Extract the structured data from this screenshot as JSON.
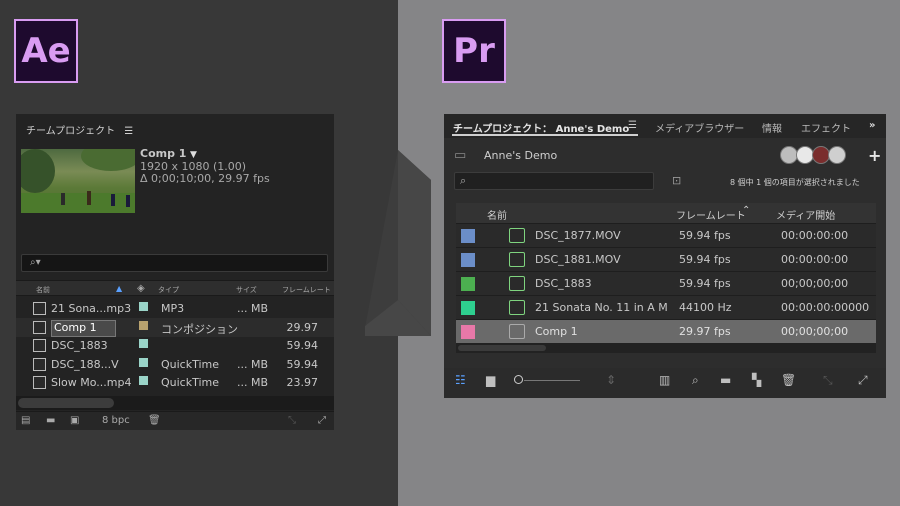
{
  "ae": {
    "logo": "Ae",
    "panel_title": "チームプロジェクト",
    "menu_icon": "hamburger-icon",
    "comp_name": "Comp 1",
    "comp_res": "1920 x 1080 (1.00)",
    "comp_dur": "Δ 0;00;10;00, 29.97 fps",
    "search_placeholder": "",
    "columns": {
      "name": "名前",
      "type": "タイプ",
      "size": "サイズ",
      "rate": "フレームレート"
    },
    "rows": [
      {
        "name": "21 Sona...mp3",
        "type": "MP3",
        "size": "... MB",
        "rate": "",
        "swatch": "#9ad4c8",
        "icon": "audio-file-icon"
      },
      {
        "name": "Comp 1",
        "type": "コンポジション",
        "size": "",
        "rate": "29.97",
        "swatch": "#b8a26e",
        "icon": "composition-icon",
        "selected": true
      },
      {
        "name": "DSC_1883",
        "type": "",
        "size": "",
        "rate": "59.94",
        "swatch": "#9ad4c8",
        "icon": "image-sequence-icon"
      },
      {
        "name": "DSC_188...V",
        "type": "QuickTime",
        "size": "... MB",
        "rate": "59.94",
        "swatch": "#9ad4c8",
        "icon": "video-file-icon"
      },
      {
        "name": "Slow Mo...mp4",
        "type": "QuickTime",
        "size": "... MB",
        "rate": "23.97",
        "swatch": "#9ad4c8",
        "icon": "video-file-icon"
      }
    ],
    "footer_bpc": "8 bpc"
  },
  "pr": {
    "logo": "Pr",
    "tabs": {
      "project": "チームプロジェクト： Anne's Demo",
      "media_browser": "メディアブラウザー",
      "info": "情報",
      "effects": "エフェクト"
    },
    "project_name": "Anne's Demo",
    "selection_status": "8 個中 1 個の項目が選択されました",
    "columns": {
      "name": "名前",
      "rate": "フレームレート",
      "start": "メディア開始"
    },
    "rows": [
      {
        "name": "DSC_1877.MOV",
        "rate": "59.94 fps",
        "start": "00:00:00:00",
        "swatch": "#6b8ec8",
        "icon": "video-clip-icon"
      },
      {
        "name": "DSC_1881.MOV",
        "rate": "59.94 fps",
        "start": "00:00:00:00",
        "swatch": "#6b8ec8",
        "icon": "video-clip-icon"
      },
      {
        "name": "DSC_1883",
        "rate": "59.94 fps",
        "start": "00;00;00;00",
        "swatch": "#4caf50",
        "icon": "image-sequence-icon"
      },
      {
        "name": "21 Sonata No. 11 in A M",
        "rate": "44100 Hz",
        "start": "00:00:00:00000",
        "swatch": "#2ecf8f",
        "icon": "audio-clip-icon"
      },
      {
        "name": "Comp 1",
        "rate": "29.97 fps",
        "start": "00;00;00;00",
        "swatch": "#e878a8",
        "icon": "composition-icon",
        "selected": true
      }
    ],
    "colors": {
      "accent": "#d99cf2",
      "logo_bg": "#1e0a2e"
    }
  }
}
